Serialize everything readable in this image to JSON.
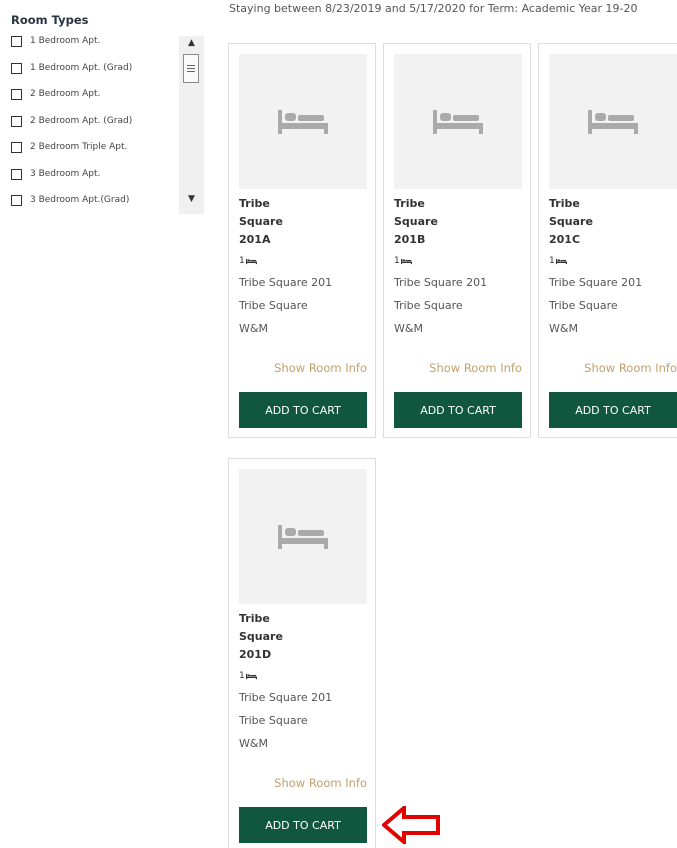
{
  "sidebar": {
    "title": "Room Types",
    "room_types": [
      "1 Bedroom Apt.",
      "1 Bedroom Apt. (Grad)",
      "2 Bedroom Apt.",
      "2 Bedroom Apt. (Grad)",
      "2 Bedroom Triple Apt.",
      "3 Bedroom Apt.",
      "3 Bedroom Apt.(Grad)"
    ]
  },
  "header": {
    "stay_text": "Staying between 8/23/2019 and 5/17/2020 for Term: Academic Year 19-20"
  },
  "cards": [
    {
      "title": "Tribe\nSquare\n201A",
      "beds": "1",
      "building_line": "Tribe Square 201",
      "area": "Tribe Square",
      "campus": "W&M",
      "info_link": "Show Room Info",
      "button": "ADD TO CART"
    },
    {
      "title": "Tribe\nSquare\n201B",
      "beds": "1",
      "building_line": "Tribe Square 201",
      "area": "Tribe Square",
      "campus": "W&M",
      "info_link": "Show Room Info",
      "button": "ADD TO CART"
    },
    {
      "title": "Tribe\nSquare\n201C",
      "beds": "1",
      "building_line": "Tribe Square 201",
      "area": "Tribe Square",
      "campus": "W&M",
      "info_link": "Show Room Info",
      "button": "ADD TO CART"
    },
    {
      "title": "Tribe\nSquare\n201D",
      "beds": "1",
      "building_line": "Tribe Square 201",
      "area": "Tribe Square",
      "campus": "W&M",
      "info_link": "Show Room Info",
      "button": "ADD TO CART"
    }
  ],
  "colors": {
    "button_bg": "#115740",
    "link": "#c2a06b",
    "annotation_arrow": "#e00000"
  }
}
